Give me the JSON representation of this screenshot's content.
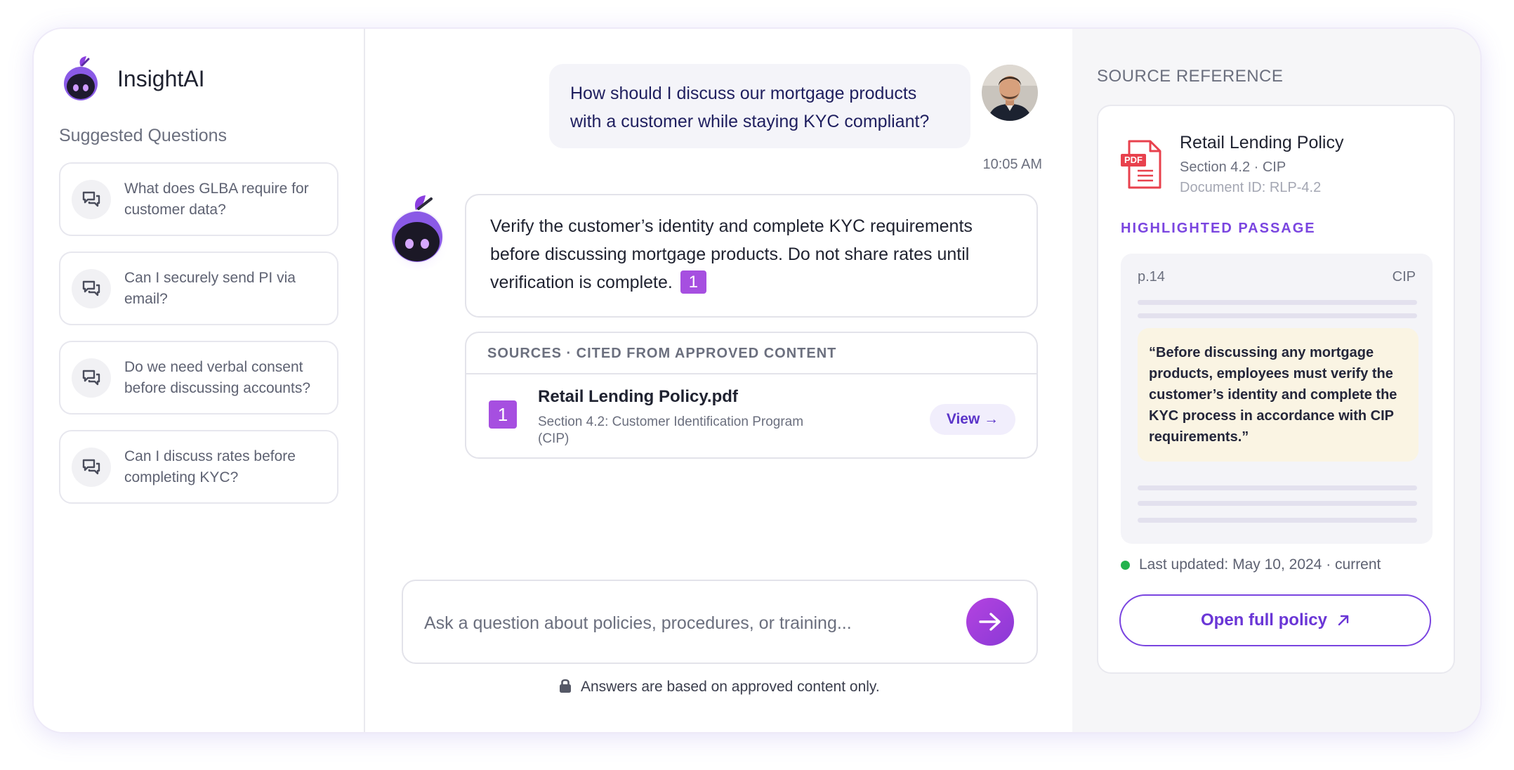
{
  "brand": {
    "name": "InsightAI"
  },
  "sidebar": {
    "title": "Suggested Questions",
    "items": [
      {
        "label": "What does GLBA require for customer data?"
      },
      {
        "label": "Can I securely send PI via email?"
      },
      {
        "label": "Do we need verbal consent before discussing accounts?"
      },
      {
        "label": "Can I discuss rates before completing KYC?"
      }
    ]
  },
  "chat": {
    "user_message": "How should I discuss our mortgage products with a customer while staying KYC compliant?",
    "timestamp": "10:05 AM",
    "answer": "Verify the customer’s identity and complete KYC requirements before discussing mortgage products. Do not share rates until verification is complete.",
    "citation_number": "1",
    "sources": {
      "header": "SOURCES · CITED FROM APPROVED CONTENT",
      "items": [
        {
          "badge": "1",
          "title": "Retail Lending Policy.pdf",
          "subtitle": "Section 4.2: Customer Identification Program (CIP)",
          "action_label": "View →"
        }
      ]
    },
    "composer": {
      "placeholder": "Ask a question about policies, procedures, or training..."
    },
    "disclaimer": "Answers are based on approved content only."
  },
  "panel": {
    "title": "SOURCE REFERENCE",
    "doc_icon_label": "PDF",
    "doc_title": "Retail Lending Policy",
    "doc_section": "Section 4.2 · CIP",
    "doc_id": "Document ID: RLP-4.2",
    "highlight_label": "HIGHLIGHTED PASSAGE",
    "page": "p.14",
    "tag": "CIP",
    "quote": "“Before discussing any mortgage products, employees must verify the customer’s identity and complete the KYC process in accordance with CIP requirements.”",
    "updated": "Last updated: May 10, 2024 · current",
    "open_button": "Open full policy"
  },
  "colors": {
    "accent": "#7a45e0",
    "citation": "#a64fe0",
    "status_ok": "#22b24c",
    "quote_bg": "#faf4e3"
  },
  "icons": [
    "brand-logo-icon",
    "chat-bubbles-icon",
    "bot-avatar-icon",
    "send-arrow-icon",
    "lock-icon",
    "pdf-file-icon",
    "external-arrow-icon"
  ]
}
